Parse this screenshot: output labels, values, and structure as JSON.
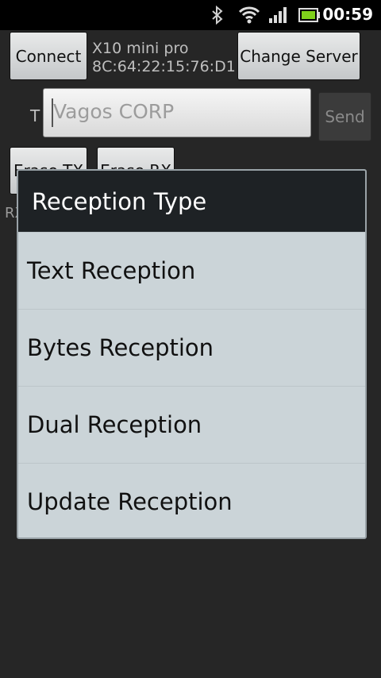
{
  "status": {
    "time": "00:59"
  },
  "toolbar": {
    "connect_label": "Connect",
    "device_name": "X10 mini pro",
    "device_mac": "8C:64:22:15:76:D1",
    "change_server_label": "Change Server"
  },
  "send_row": {
    "label": "T",
    "input_value": "Vagos CORP",
    "send_label": "Send"
  },
  "background": {
    "erase_tx_label": "Erase TX",
    "erase_rx_label": "Erase RX",
    "rx_label": "RX"
  },
  "dialog": {
    "title": "Reception Type",
    "items": [
      "Text Reception",
      "Bytes Reception",
      "Dual Reception",
      "Update Reception"
    ]
  }
}
